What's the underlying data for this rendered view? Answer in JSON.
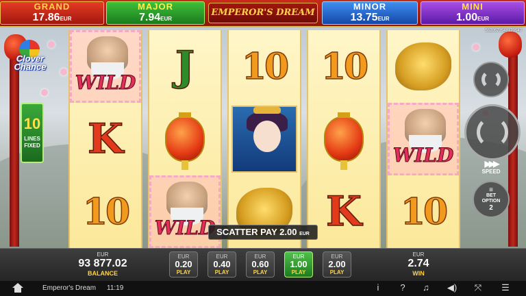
{
  "jackpots": {
    "grand": {
      "name": "GRAND",
      "value": "17.86",
      "currency": "EUR"
    },
    "major": {
      "name": "MAJOR",
      "value": "7.94",
      "currency": "EUR"
    },
    "minor": {
      "name": "MINOR",
      "value": "13.75",
      "currency": "EUR"
    },
    "mini": {
      "name": "MINI",
      "value": "1.00",
      "currency": "EUR"
    }
  },
  "logo": "EMPEROR'S DREAM",
  "ticket_id": "5520573548170547",
  "side": {
    "clover_brand": "Clover Chance",
    "lines_count": "10",
    "lines_label": "LINES FIXED"
  },
  "reels": [
    [
      "wild",
      "K",
      "10"
    ],
    [
      "J",
      "lantern",
      "wild"
    ],
    [
      "10",
      "geisha",
      "dragon"
    ],
    [
      "10",
      "lantern",
      "K"
    ],
    [
      "dragon",
      "wild",
      "10"
    ]
  ],
  "symbols": {
    "wild_label": "WILD"
  },
  "controls": {
    "speed_label": "SPEED",
    "bet_option_label": "BET OPTION",
    "bet_option_value": "2"
  },
  "scatter": {
    "label": "SCATTER PAY",
    "value": "2.00",
    "currency": "EUR"
  },
  "balance": {
    "currency": "EUR",
    "value": "93 877.02",
    "label": "BALANCE"
  },
  "bets": [
    {
      "currency": "EUR",
      "amount": "0.20",
      "action": "PLAY",
      "active": false
    },
    {
      "currency": "EUR",
      "amount": "0.40",
      "action": "PLAY",
      "active": false
    },
    {
      "currency": "EUR",
      "amount": "0.60",
      "action": "PLAY",
      "active": false
    },
    {
      "currency": "EUR",
      "amount": "1.00",
      "action": "PLAY",
      "active": true
    },
    {
      "currency": "EUR",
      "amount": "2.00",
      "action": "PLAY",
      "active": false
    }
  ],
  "win": {
    "currency": "EUR",
    "value": "2.74",
    "label": "WIN"
  },
  "statusbar": {
    "game_name": "Emperor's Dream",
    "time": "11:19",
    "icons": [
      "home-icon",
      "info-icon",
      "help-icon",
      "music-icon",
      "volume-icon",
      "fullscreen-icon",
      "menu-icon"
    ]
  },
  "colors": {
    "grand": "#c92b1a",
    "major": "#2e9e2e",
    "minor": "#2a6ed0",
    "mini": "#7a32c6",
    "active_bet": "#3aa83a"
  }
}
